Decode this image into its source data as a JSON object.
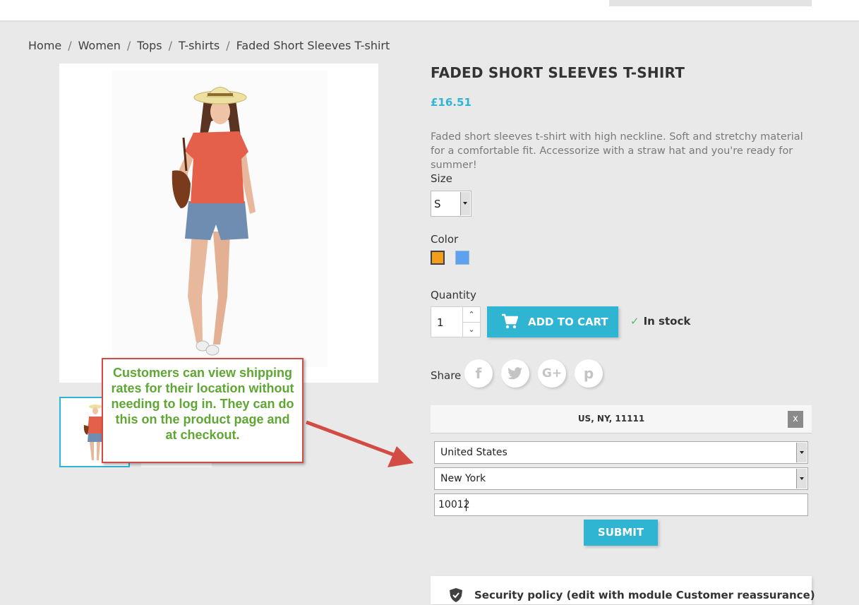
{
  "breadcrumb": [
    "Home",
    "Women",
    "Tops",
    "T-shirts",
    "Faded Short Sleeves T-shirt"
  ],
  "product": {
    "title": "FADED SHORT SLEEVES T-SHIRT",
    "price": "£16.51",
    "description": "Faded short sleeves t-shirt with high neckline. Soft and stretchy material for a comfortable fit. Accessorize with a straw hat and you're ready for summer!"
  },
  "size": {
    "label": "Size",
    "selected": "S"
  },
  "color": {
    "label": "Color",
    "swatches": [
      {
        "name": "orange",
        "hex": "#f39d1c",
        "selected": true
      },
      {
        "name": "blue",
        "hex": "#5ea1ec",
        "selected": false
      }
    ]
  },
  "quantity": {
    "label": "Quantity",
    "value": "1"
  },
  "cart": {
    "add_label": "ADD TO CART",
    "stock_label": "In stock"
  },
  "share": {
    "label": "Share",
    "networks": [
      "facebook-icon",
      "twitter-icon",
      "google-plus-icon",
      "pinterest-icon"
    ]
  },
  "shipping": {
    "location_summary": "US, NY, 11111",
    "close_label": "x",
    "country": "United States",
    "state": "New York",
    "zip": "10012",
    "submit_label": "SUBMIT"
  },
  "reassurance": {
    "text": "Security policy (edit with module Customer reassurance)"
  },
  "callout": {
    "text": "Customers can view shipping rates for their location without needing to log in. They can do this on the product page and at checkout."
  },
  "colors": {
    "accent": "#2fb5d2",
    "callout_border": "#d24b44",
    "callout_text": "#5fa634"
  }
}
